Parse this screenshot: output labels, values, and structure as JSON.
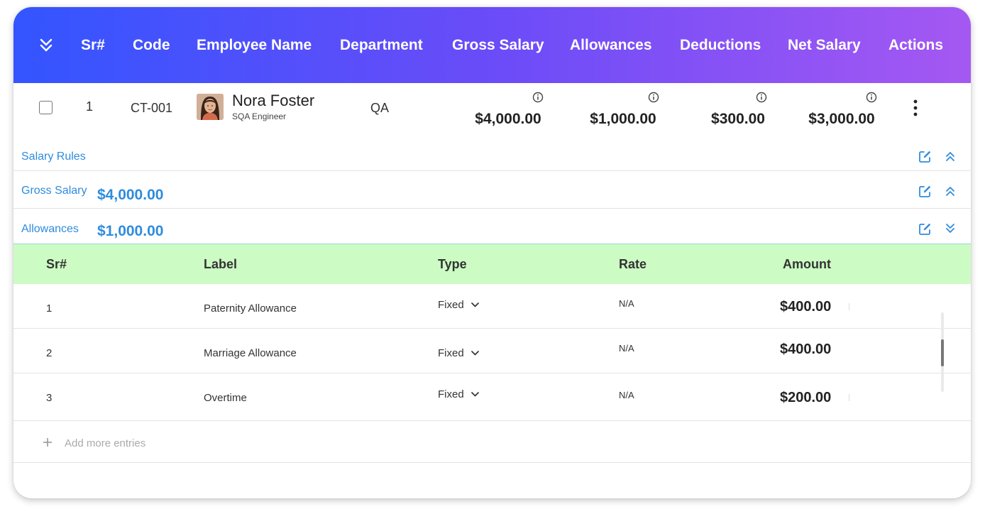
{
  "header": {
    "columns": {
      "sr": "Sr#",
      "code": "Code",
      "employee_name": "Employee Name",
      "department": "Department",
      "gross_salary": "Gross Salary",
      "allowances": "Allowances",
      "deductions": "Deductions",
      "net_salary": "Net Salary",
      "actions": "Actions"
    },
    "icons": {
      "toggle": "chevron-double-down-icon"
    }
  },
  "employee": {
    "sr": "1",
    "code": "CT-001",
    "name": "Nora Foster",
    "role": "SQA Engineer",
    "department": "QA",
    "gross_salary": "$4,000.00",
    "allowances": "$1,000.00",
    "deductions": "$300.00",
    "net_salary": "$3,000.00",
    "icons": {
      "info": "info-icon",
      "actions": "kebab-menu-icon"
    }
  },
  "salary_rules": {
    "label": "Salary Rules",
    "gross": {
      "label": "Gross Salary",
      "value": "$4,000.00"
    },
    "allowances": {
      "label": "Allowances",
      "value": "$1,000.00"
    }
  },
  "allowance_table": {
    "headers": {
      "sr": "Sr#",
      "label": "Label",
      "type": "Type",
      "rate": "Rate",
      "amount": "Amount"
    },
    "rows": [
      {
        "sr": "1",
        "label": "Paternity Allowance",
        "type": "Fixed",
        "rate": "N/A",
        "amount": "$400.00"
      },
      {
        "sr": "2",
        "label": "Marriage Allowance",
        "type": "Fixed",
        "rate": "N/A",
        "amount": "$400.00"
      },
      {
        "sr": "3",
        "label": "Overtime",
        "type": "Fixed",
        "rate": "N/A",
        "amount": "$200.00"
      }
    ],
    "add_label": "Add more entries"
  },
  "colors": {
    "gradient_start": "#3355ff",
    "gradient_end": "#a558f2",
    "accent": "#2f8cdc",
    "table_header": "#ccfcc4"
  }
}
